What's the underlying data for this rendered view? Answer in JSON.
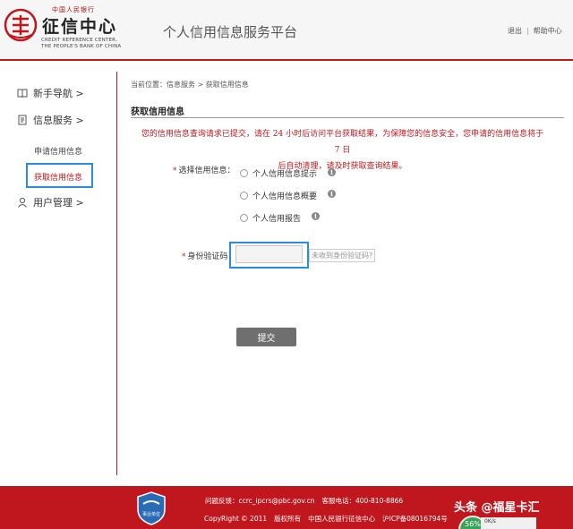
{
  "header": {
    "logo_top": "中国人民银行",
    "logo_cn": "征信中心",
    "logo_en_line1": "CREDIT REFERENCE CENTER,",
    "logo_en_line2": "THE PEOPLE'S BANK OF CHINA",
    "platform_title": "个人信用信息服务平台",
    "logout_label": "退出",
    "separator": "|",
    "help_label": "帮助中心"
  },
  "sidebar": {
    "guide_label": "新手导航 >",
    "info_service_label": "信息服务 >",
    "apply_label": "申请信用信息",
    "retrieve_label": "获取信用信息",
    "user_mgmt_label": "用户管理 >"
  },
  "main": {
    "breadcrumb": "当前位置：信息服务 > 获取信用信息",
    "section_title": "获取信用信息",
    "notice_line1": "您的信用信息查询请求已提交，请在 24 小时后访问平台获取结果，为保障您的信息安全，您申请的信用信息将于 7 日",
    "notice_line2": "后自动清理，请及时获取查询结果。",
    "select_label": "选择信用信息：",
    "required_mark": "*",
    "options": [
      "个人信用信息提示",
      "个人信用信息概要",
      "个人信用报告"
    ],
    "info_icon_glyph": "i",
    "id_code_label": "身份验证码：",
    "id_code_value": "",
    "resend_label": "未收到身份验证码?",
    "submit_label": "提交"
  },
  "footer": {
    "badge_text": "事业单位",
    "feedback_label": "问题反馈：",
    "feedback_email": "ccrc_ipcrs@pbc.gov.cn",
    "phone_label": "客服电话：",
    "phone": "400-810-8866",
    "copyright": "CopyRight © 2011",
    "rights": "版权所有",
    "org": "中国人民银行征信中心",
    "icp": "沪ICP备08016794号"
  },
  "overlay": {
    "watermark": "头条 @福星卡汇",
    "speed_percent": "56%",
    "speed_rate": "0K/s"
  },
  "colors": {
    "accent_red": "#c0161e",
    "highlight_blue": "#2a8ce0",
    "button_gray": "#6f6f6f"
  }
}
